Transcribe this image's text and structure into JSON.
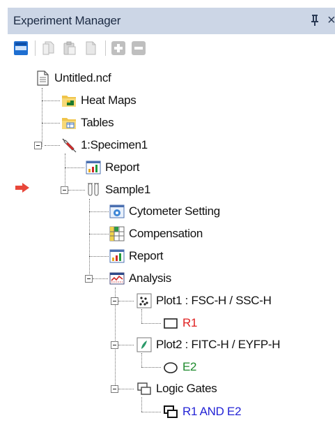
{
  "panel": {
    "title": "Experiment Manager"
  },
  "toolbar": {
    "buttons": [
      "panel-layout-icon",
      "copy-icon",
      "paste-icon",
      "document-icon",
      "add-icon",
      "remove-icon"
    ]
  },
  "tree": {
    "root": "Untitled.ncf",
    "heat_maps": "Heat Maps",
    "tables": "Tables",
    "specimen": "1:Specimen1",
    "specimen_report": "Report",
    "sample": "Sample1",
    "cytometer_setting": "Cytometer Setting",
    "compensation": "Compensation",
    "sample_report": "Report",
    "analysis": "Analysis",
    "plot1": "Plot1 : FSC-H / SSC-H",
    "gate_r1": "R1",
    "plot2": "Plot2 : FITC-H / EYFP-H",
    "gate_e2": "E2",
    "logic_gates": "Logic Gates",
    "logic_gate_1": "R1 AND E2"
  },
  "colors": {
    "titlebar_bg": "#ccd6e6",
    "gate_r1": "#e02020",
    "gate_e2": "#1d8a2c",
    "logic_gate": "#2424d6",
    "current_marker": "#e8473a"
  }
}
